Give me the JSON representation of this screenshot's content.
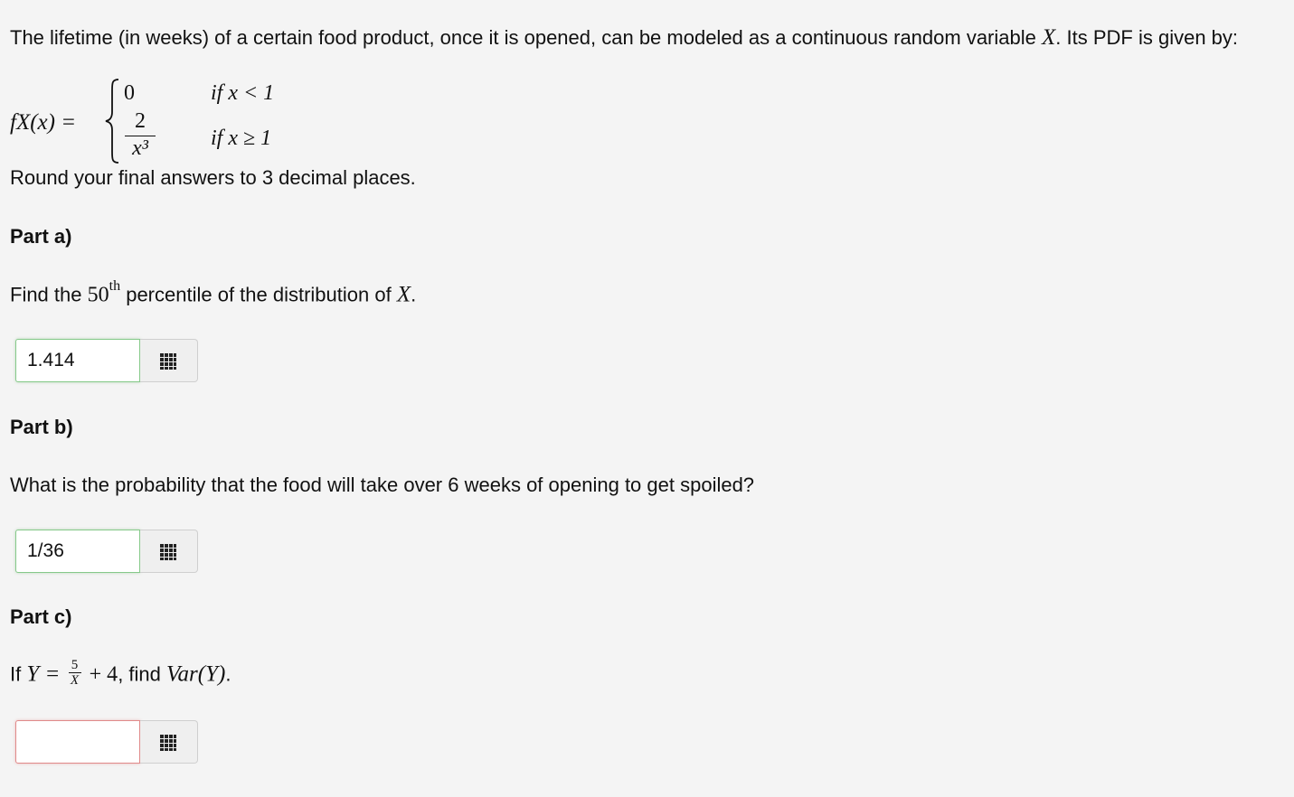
{
  "intro": {
    "text_before": "The lifetime (in weeks) of a certain food product, once it is opened, can be modeled as a continuous random variable",
    "var": "X",
    "text_after": ". Its PDF is given by:"
  },
  "pdf": {
    "lhs": "fX(x) =",
    "case1_value": "0",
    "case1_condition": "if x < 1",
    "case2_numerator": "2",
    "case2_denominator": "x³",
    "case2_condition": "if x ≥ 1"
  },
  "rounding_note": "Round your final answers to 3 decimal places.",
  "part_a": {
    "heading": "Part a)",
    "question_before": "Find the",
    "percentile_number": "50",
    "percentile_suffix": "th",
    "question_after": "percentile of the distribution of",
    "var": "X",
    "period": ".",
    "answer_value": "1.414",
    "answer_status": "correct"
  },
  "part_b": {
    "heading": "Part b)",
    "question": "What is the probability that the food will take over 6 weeks of opening to get spoiled?",
    "answer_value": "1/36",
    "answer_status": "correct"
  },
  "part_c": {
    "heading": "Part c)",
    "question_prefix": "If",
    "lhs": "Y =",
    "frac_num": "5",
    "frac_den": "X",
    "plus_term": "+ 4",
    "question_middle": ", find",
    "var_expr": "Var(Y)",
    "period": ".",
    "answer_value": "",
    "answer_status": "incorrect"
  },
  "icons": {
    "answer_button": "grid-icon"
  },
  "colors": {
    "background": "#f4f4f4",
    "correct_border": "#86c98a",
    "incorrect_border": "#e08a8a"
  }
}
